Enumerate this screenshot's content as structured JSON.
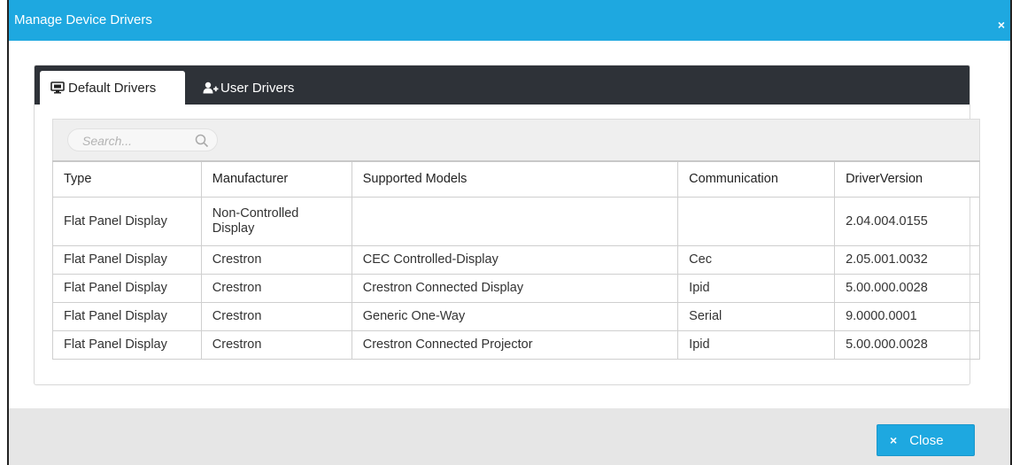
{
  "dialog": {
    "title": "Manage Device Drivers",
    "close_glyph": "×"
  },
  "tabs": [
    {
      "label": "Default Drivers",
      "icon": "monitor-icon",
      "active": true
    },
    {
      "label": "User Drivers",
      "icon": "add-user-icon",
      "active": false
    }
  ],
  "search": {
    "placeholder": "Search...",
    "value": "",
    "icon": "search-icon"
  },
  "table": {
    "headers": [
      "Type",
      "Manufacturer",
      "Supported Models",
      "Communication",
      "DriverVersion"
    ],
    "rows": [
      [
        "Flat Panel Display",
        "Non-Controlled Display",
        "",
        "",
        "2.04.004.0155"
      ],
      [
        "Flat Panel Display",
        "Crestron",
        "CEC Controlled-Display",
        "Cec",
        "2.05.001.0032"
      ],
      [
        "Flat Panel Display",
        "Crestron",
        "Crestron Connected Display",
        "Ipid",
        "5.00.000.0028"
      ],
      [
        "Flat Panel Display",
        "Crestron",
        "Generic One-Way",
        "Serial",
        "9.0000.0001"
      ],
      [
        "Flat Panel Display",
        "Crestron",
        "Crestron Connected Projector",
        "Ipid",
        "5.00.000.0028"
      ]
    ]
  },
  "footer": {
    "close_label": "Close",
    "close_glyph": "×"
  },
  "colors": {
    "accent": "#1ea8e0",
    "tabbar": "#2e3238",
    "footer": "#e6e6e6"
  }
}
